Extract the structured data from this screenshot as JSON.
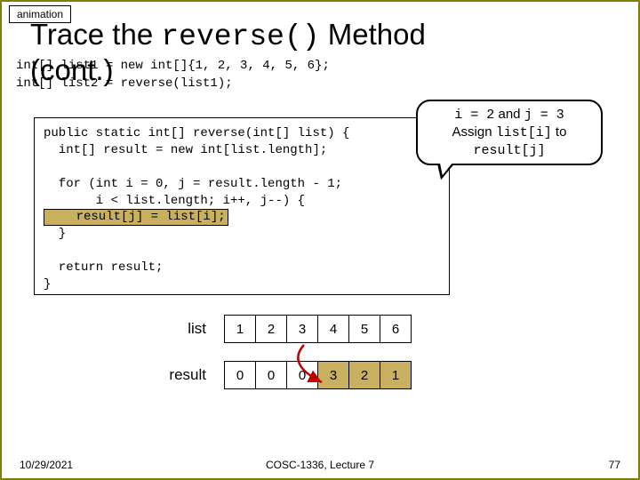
{
  "anim_label": "animation",
  "title_part1": "Trace the ",
  "title_mono": "reverse()",
  "title_part2": " Method",
  "cont_text": "(cont.)",
  "intro_code": "int[] list1 = new int[]{1, 2, 3, 4, 5, 6};\nint[] list2 = reverse(list1);",
  "callout": {
    "line1a": "i = 2",
    "line1b": " and ",
    "line1c": "j = 3",
    "line2a": "Assign ",
    "line2b": "list[i]",
    "line2c": " to",
    "line3": "result[j]"
  },
  "code": {
    "l1": "public static int[] reverse(int[] list) {",
    "l2": "  int[] result = new int[list.length];",
    "l3": "",
    "l4": "  for (int i = 0, j = result.length - 1;",
    "l5": "       i < list.length; i++, j--) {",
    "hl": "    result[j] = list[i];",
    "l7": "  }",
    "l8": "",
    "l9": "  return result;",
    "l10": "}"
  },
  "arrays": {
    "list_label": "list",
    "result_label": "result",
    "list": [
      "1",
      "2",
      "3",
      "4",
      "5",
      "6"
    ],
    "result": [
      "0",
      "0",
      "0",
      "3",
      "2",
      "1"
    ]
  },
  "footer": {
    "date": "10/29/2021",
    "center": "COSC-1336, Lecture 7",
    "page": "77"
  }
}
